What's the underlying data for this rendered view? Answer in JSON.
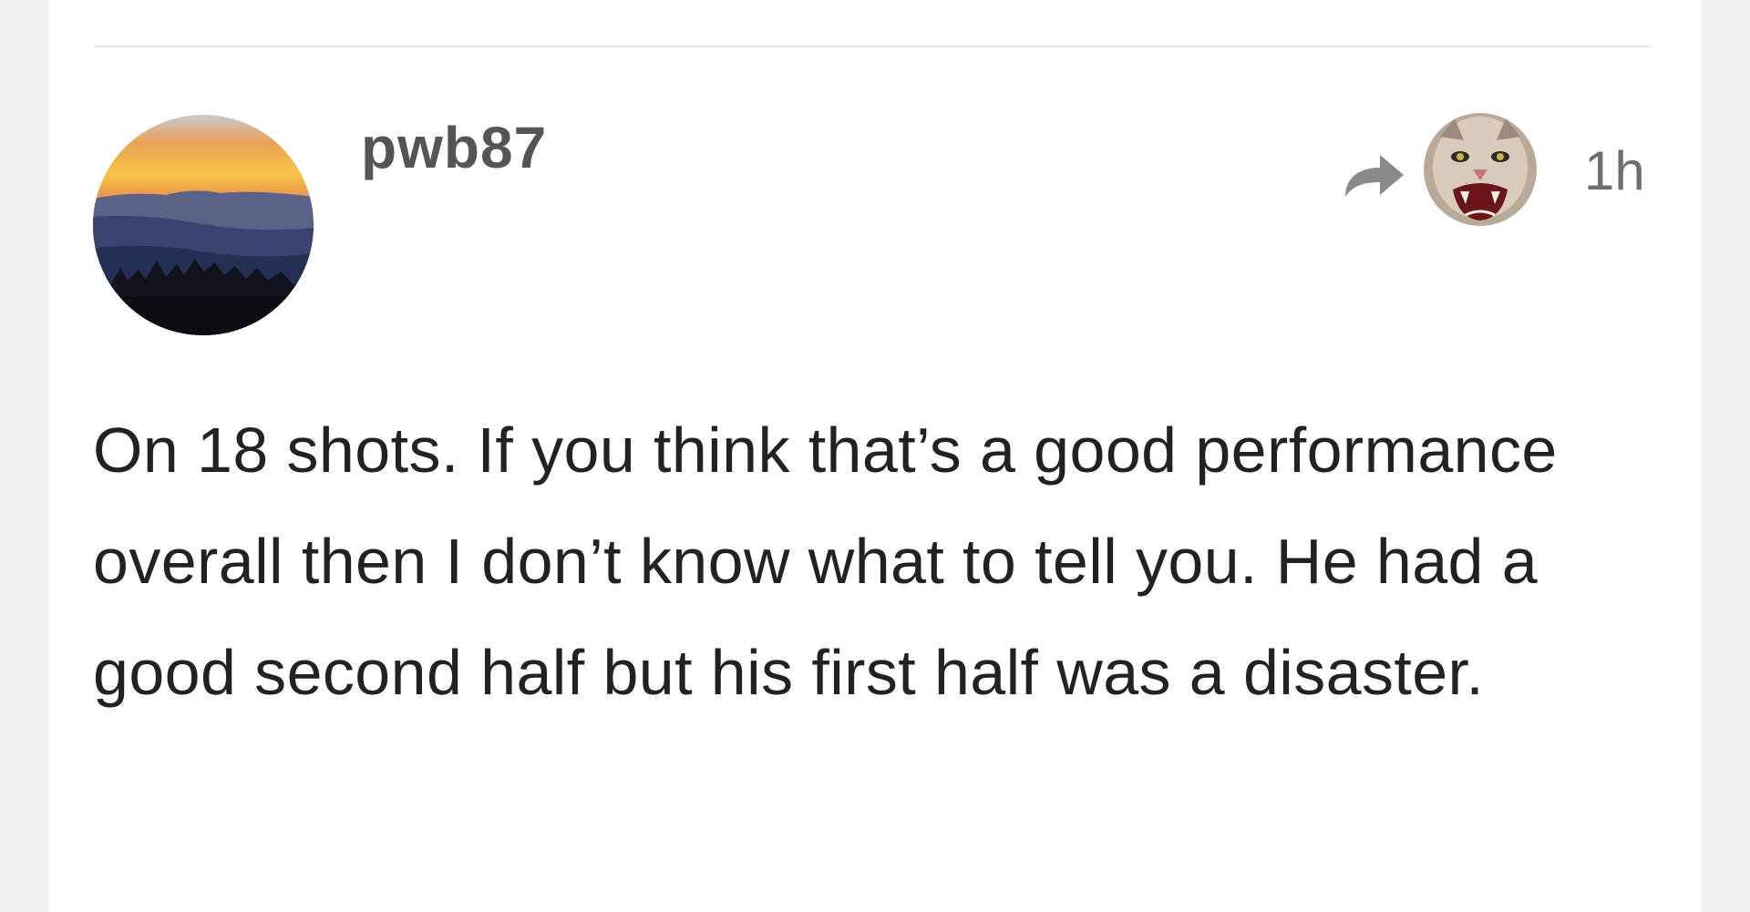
{
  "post": {
    "username": "pwb87",
    "timestamp": "1h",
    "body": "On 18 shots. If you think that’s a good performance overall then I don’t know what to tell you. He had a good second half but his first half was a disaster.",
    "author_avatar": "sunset-mountains-avatar",
    "reply_avatar": "cougar-avatar",
    "share_icon": "reply-arrow-icon"
  },
  "colors": {
    "page_background": "#f1f1f1",
    "card_background": "#ffffff",
    "username": "#555555",
    "body_text": "#222222",
    "icon": "#8a8a8a"
  }
}
